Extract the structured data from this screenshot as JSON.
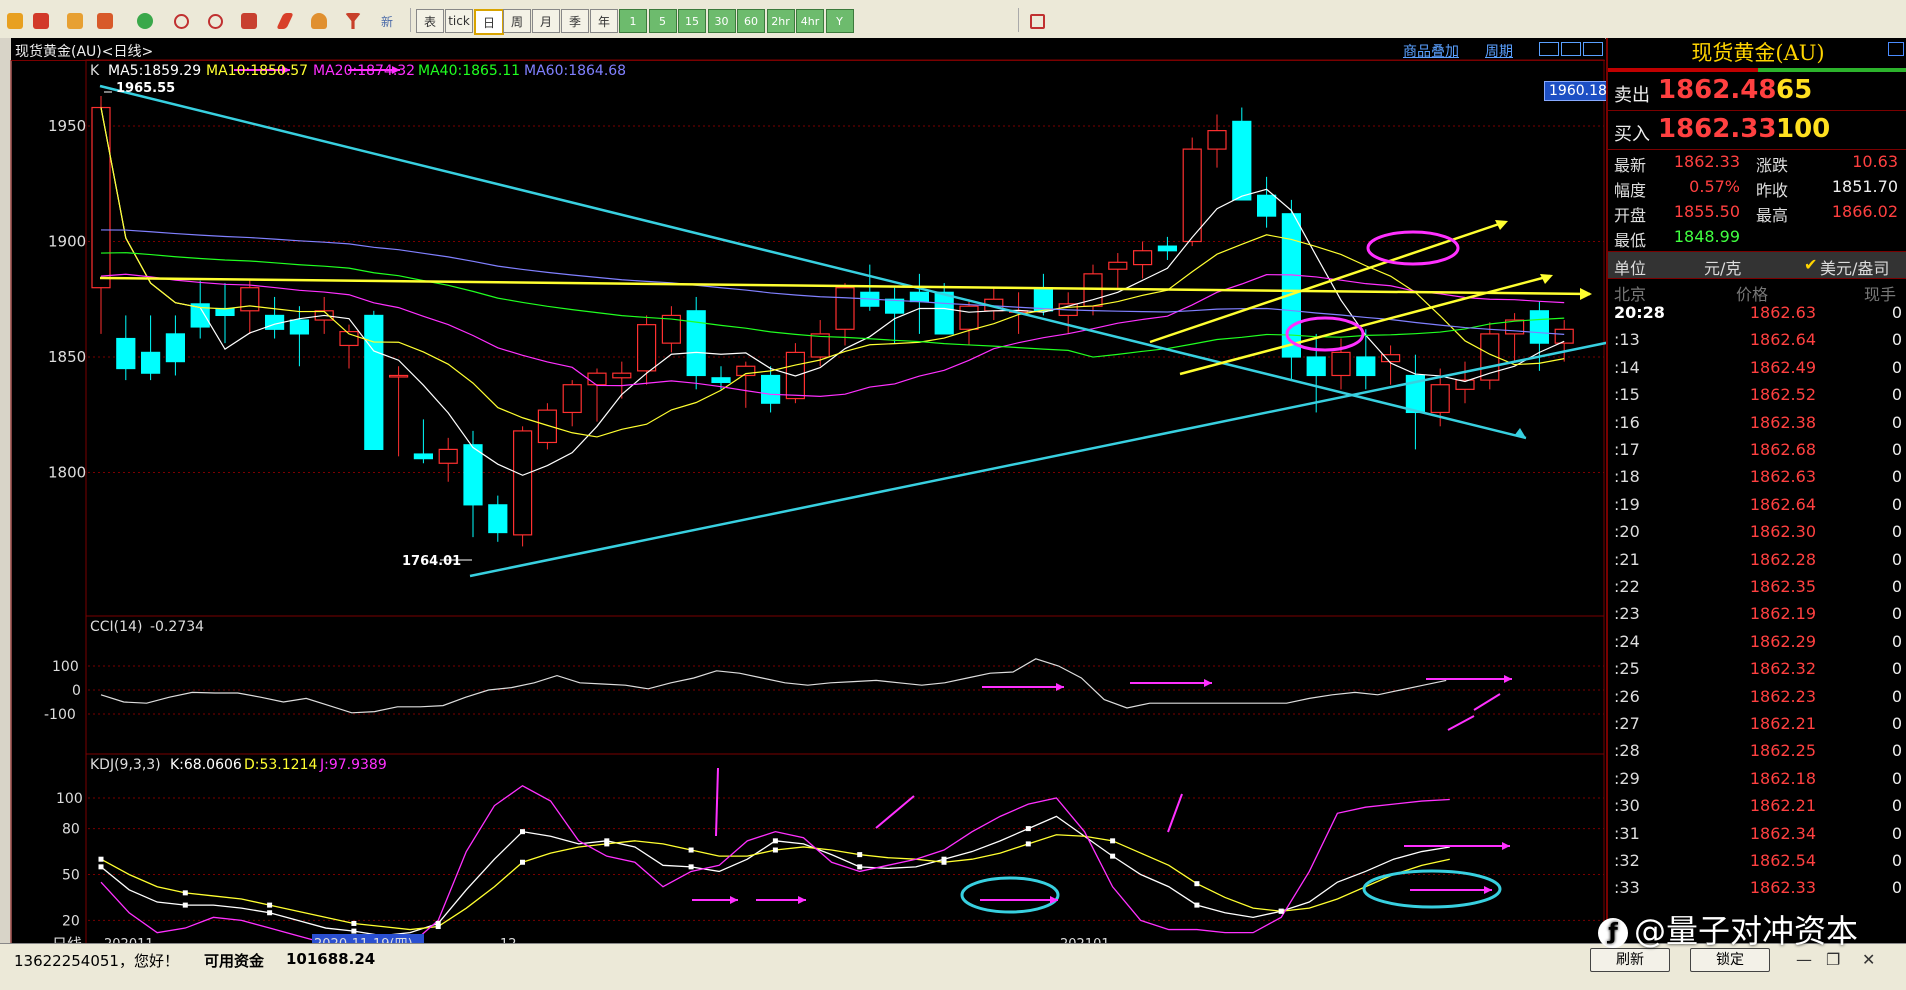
{
  "toolbar": {
    "icons": [
      "back-arrow-icon",
      "home-icon",
      "folder-icon",
      "news-icon",
      "refresh-icon",
      "zoom-in-icon",
      "zoom-out-icon",
      "window-icon",
      "pen-icon",
      "bell-icon",
      "filter-icon"
    ],
    "new_label": "新",
    "periods": [
      "表",
      "tick",
      "日",
      "周",
      "月",
      "季",
      "年",
      "1",
      "5",
      "15",
      "30",
      "60",
      "2hr",
      "4hr",
      "Y"
    ],
    "active_period": "日",
    "last_icon": "calendar-icon"
  },
  "chart_header": {
    "title": "现货黄金(AU)<日线>",
    "overlay_link": "商品叠加",
    "cycle_link": "周期"
  },
  "main_chart": {
    "legend_k": "K",
    "ma5": "MA5:1859.29",
    "ma10": "MA10:1850.57",
    "ma20": "MA20:1874.32",
    "ma40": "MA40:1865.11",
    "ma60": "MA60:1864.68",
    "high_label": "1965.55",
    "low_label": "1764.01",
    "current_tag": "1960.18",
    "y_ticks": [
      "1950",
      "1900",
      "1850",
      "1800"
    ],
    "colors": {
      "ma5": "#ffffff",
      "ma10": "#ffff30",
      "ma20": "#ff30ff",
      "ma40": "#20ff20",
      "ma60": "#8080ff",
      "up": "#ff3030",
      "down": "#00ffff"
    }
  },
  "cci": {
    "label": "CCI(14)",
    "value": "-0.2734",
    "y_ticks": [
      "100",
      "0",
      "-100"
    ]
  },
  "kdj": {
    "label": "KDJ(9,3,3)",
    "k": "K:68.0606",
    "d": "D:53.1214",
    "j": "J:97.9389",
    "y_ticks": [
      "100",
      "80",
      "50",
      "20",
      "0"
    ]
  },
  "x_axis": {
    "label": "日线",
    "ticks": [
      "202011",
      "2020-11-19(四)",
      "12",
      "202101"
    ]
  },
  "quote_panel": {
    "title": "现货黄金(AU)",
    "sell_label": "卖出",
    "sell_price": "1862.48",
    "sell_vol": "65",
    "buy_label": "买入",
    "buy_price": "1862.33",
    "buy_vol": "100",
    "stats": [
      {
        "label": "最新",
        "value": "1862.33",
        "label2": "涨跌",
        "value2": "10.63"
      },
      {
        "label": "幅度",
        "value": "0.57%",
        "label2": "昨收",
        "value2": "1851.70"
      },
      {
        "label": "开盘",
        "value": "1855.50",
        "label2": "最高",
        "value2": "1866.02"
      },
      {
        "label": "最低",
        "value": "1848.99",
        "label2": "",
        "value2": ""
      }
    ],
    "unit_label": "单位",
    "unit_value": "元/克",
    "unit_alt": "美元/盎司",
    "tick_headers": [
      "北京",
      "价格",
      "现手"
    ],
    "ticks": [
      {
        "time": "20:28",
        "price": "1862.63",
        "qty": "0"
      },
      {
        "time": ":13",
        "price": "1862.64",
        "qty": "0"
      },
      {
        "time": ":14",
        "price": "1862.49",
        "qty": "0"
      },
      {
        "time": ":15",
        "price": "1862.52",
        "qty": "0"
      },
      {
        "time": ":16",
        "price": "1862.38",
        "qty": "0"
      },
      {
        "time": ":17",
        "price": "1862.68",
        "qty": "0"
      },
      {
        "time": ":18",
        "price": "1862.63",
        "qty": "0"
      },
      {
        "time": ":19",
        "price": "1862.64",
        "qty": "0"
      },
      {
        "time": ":20",
        "price": "1862.30",
        "qty": "0"
      },
      {
        "time": ":21",
        "price": "1862.28",
        "qty": "0"
      },
      {
        "time": ":22",
        "price": "1862.35",
        "qty": "0"
      },
      {
        "time": ":23",
        "price": "1862.19",
        "qty": "0"
      },
      {
        "time": ":24",
        "price": "1862.29",
        "qty": "0"
      },
      {
        "time": ":25",
        "price": "1862.32",
        "qty": "0"
      },
      {
        "time": ":26",
        "price": "1862.23",
        "qty": "0"
      },
      {
        "time": ":27",
        "price": "1862.21",
        "qty": "0"
      },
      {
        "time": ":28",
        "price": "1862.25",
        "qty": "0"
      },
      {
        "time": ":29",
        "price": "1862.18",
        "qty": "0"
      },
      {
        "time": ":30",
        "price": "1862.21",
        "qty": "0"
      },
      {
        "time": ":31",
        "price": "1862.34",
        "qty": "0"
      },
      {
        "time": ":32",
        "price": "1862.54",
        "qty": "0"
      },
      {
        "time": ":33",
        "price": "1862.33",
        "qty": "0"
      }
    ]
  },
  "statusbar": {
    "greeting": "13622254051，您好！",
    "funds_label": "可用资金",
    "funds_value": "101688.24",
    "refresh": "刷新",
    "lock": "锁定"
  },
  "watermark": "@量子对冲资本"
}
